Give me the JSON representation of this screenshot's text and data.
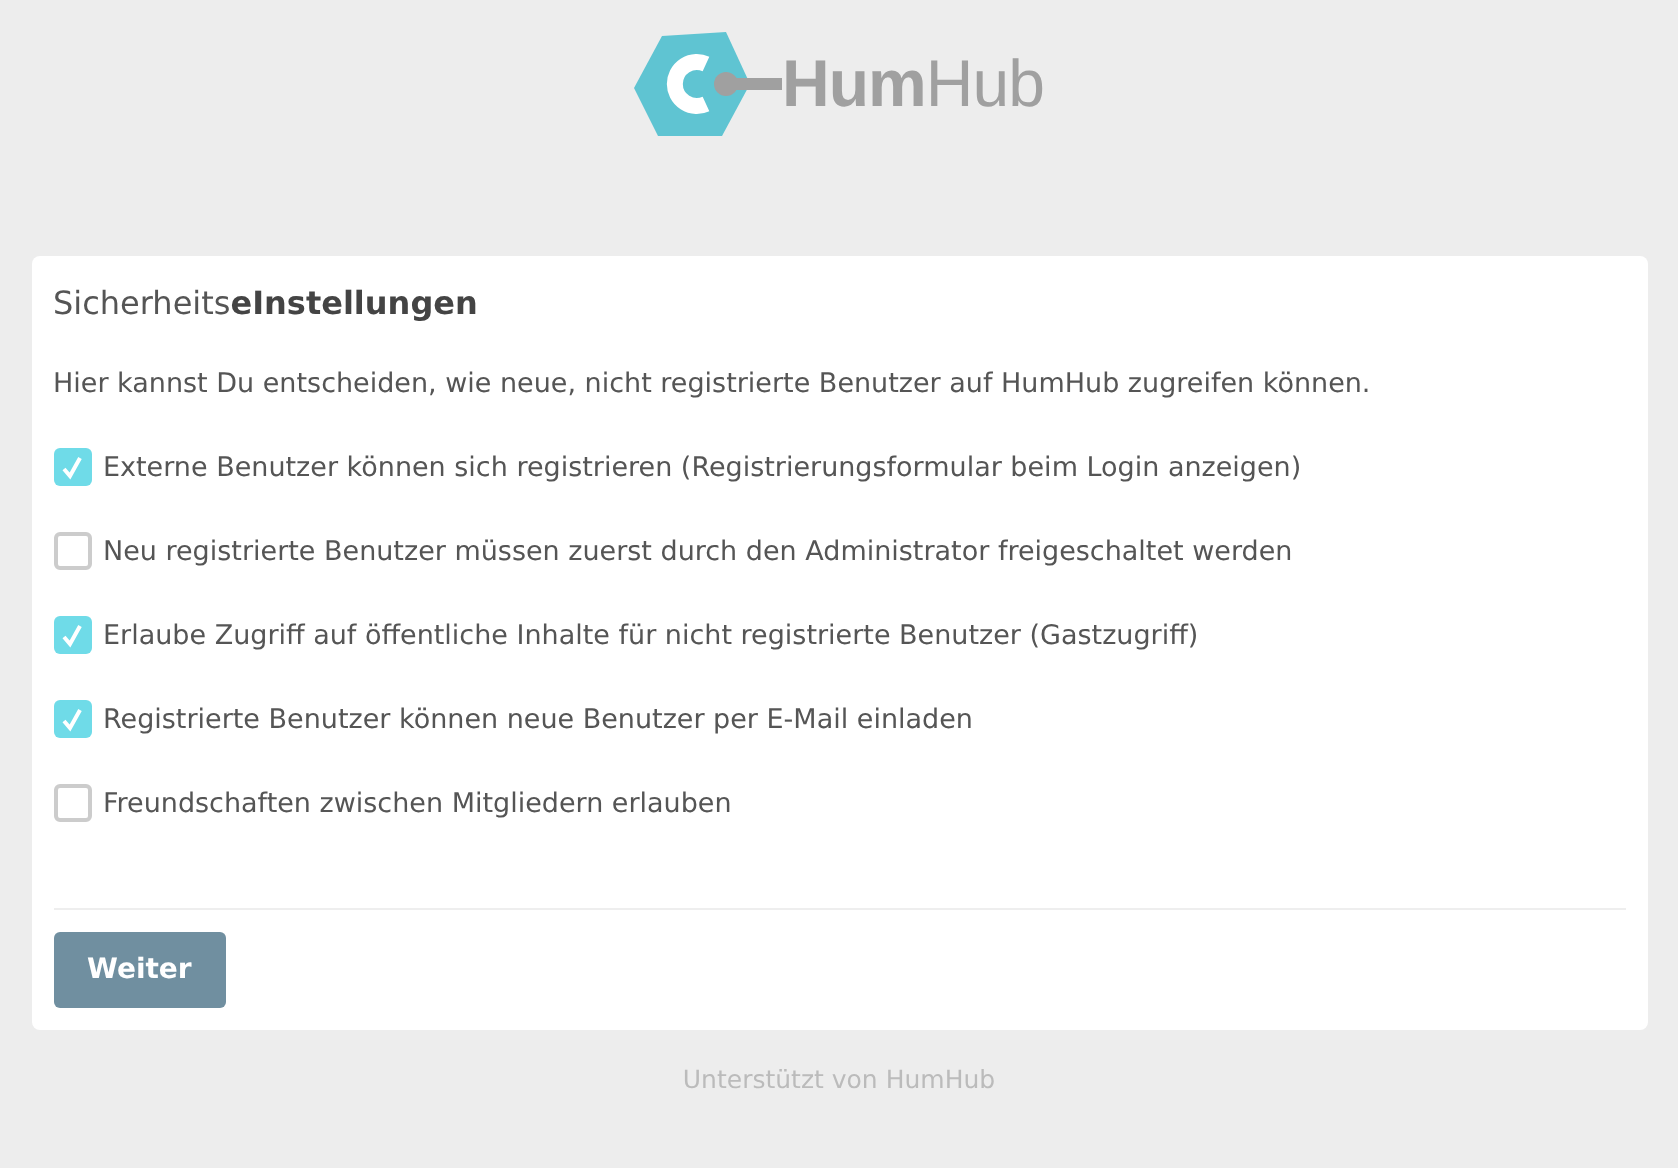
{
  "logo": {
    "bold_part": "Hum",
    "light_part": "Hub"
  },
  "panel": {
    "heading": "Sicherheits**eInstellungen**",
    "intro": "Hier kannst Du entscheiden, wie neue, nicht registrierte Benutzer auf HumHub zugreifen können.",
    "options": [
      {
        "label": "Externe Benutzer können sich registrieren (Registrierungsformular beim Login anzeigen)",
        "checked": true
      },
      {
        "label": "Neu registrierte Benutzer müssen zuerst durch den Administrator freigeschaltet werden",
        "checked": false
      },
      {
        "label": "Erlaube Zugriff auf öffentliche Inhalte für nicht registrierte Benutzer (Gastzugriff)",
        "checked": true
      },
      {
        "label": "Registrierte Benutzer können neue Benutzer per E-Mail einladen",
        "checked": true
      },
      {
        "label": "Freundschaften zwischen Mitgliedern erlauben",
        "checked": false
      }
    ],
    "button": "Weiter"
  },
  "footer": "Unterstützt von HumHub"
}
